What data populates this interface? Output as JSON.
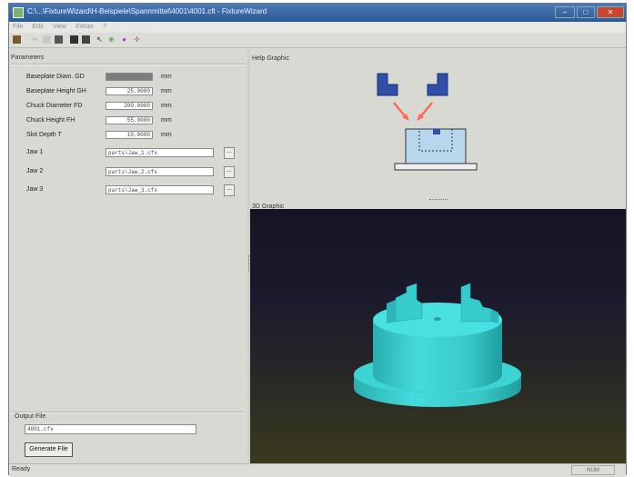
{
  "window": {
    "title": "C:\\...\\FixtureWizard\\H-Beispiele\\Spannmittel\\4001\\4001.cft - FixtureWizard",
    "minimize_glyph": "–",
    "maximize_glyph": "□",
    "close_glyph": "✕"
  },
  "menu": [
    "File",
    "Edit",
    "View",
    "Extras",
    "?"
  ],
  "toolbar_icons": [
    "open-icon",
    "cut-icon",
    "copy-icon",
    "paste-icon",
    "print-icon",
    "print-preview-icon",
    "pointer-icon",
    "add-icon",
    "delete-icon",
    "move-icon"
  ],
  "parameters": {
    "title": "Parameters",
    "rows": [
      {
        "label": "Baseplate Diam. GD",
        "value": "",
        "unit": "mm"
      },
      {
        "label": "Baseplate Height GH",
        "value": "25.0000",
        "unit": "mm"
      },
      {
        "label": "Chuck Diameter FD",
        "value": "200.0000",
        "unit": "mm"
      },
      {
        "label": "Chuck Height FH",
        "value": "55.0000",
        "unit": "mm"
      },
      {
        "label": "Slot Depth T",
        "value": "10.0000",
        "unit": "mm"
      }
    ],
    "jaws": [
      {
        "label": "Jaw 1",
        "value": "parts\\Jaw_1.cfx",
        "button": "..."
      },
      {
        "label": "Jaw 2",
        "value": "parts\\Jaw_2.cfx",
        "button": "..."
      },
      {
        "label": "Jaw 3",
        "value": "parts\\Jaw_3.cfx",
        "button": "..."
      }
    ]
  },
  "output": {
    "title": "Output File",
    "value": "4001.cfx",
    "button": "Generate File"
  },
  "help_graphic": {
    "title": "Help Graphic"
  },
  "graphic_3d": {
    "title": "3D Graphic"
  },
  "status": {
    "text": "Ready",
    "num": "NUM"
  },
  "colors": {
    "titlebar": "#3a68a8",
    "model": "#36d0d0",
    "jaw": "#2f4fa8",
    "arrow": "#ff6a4d"
  }
}
